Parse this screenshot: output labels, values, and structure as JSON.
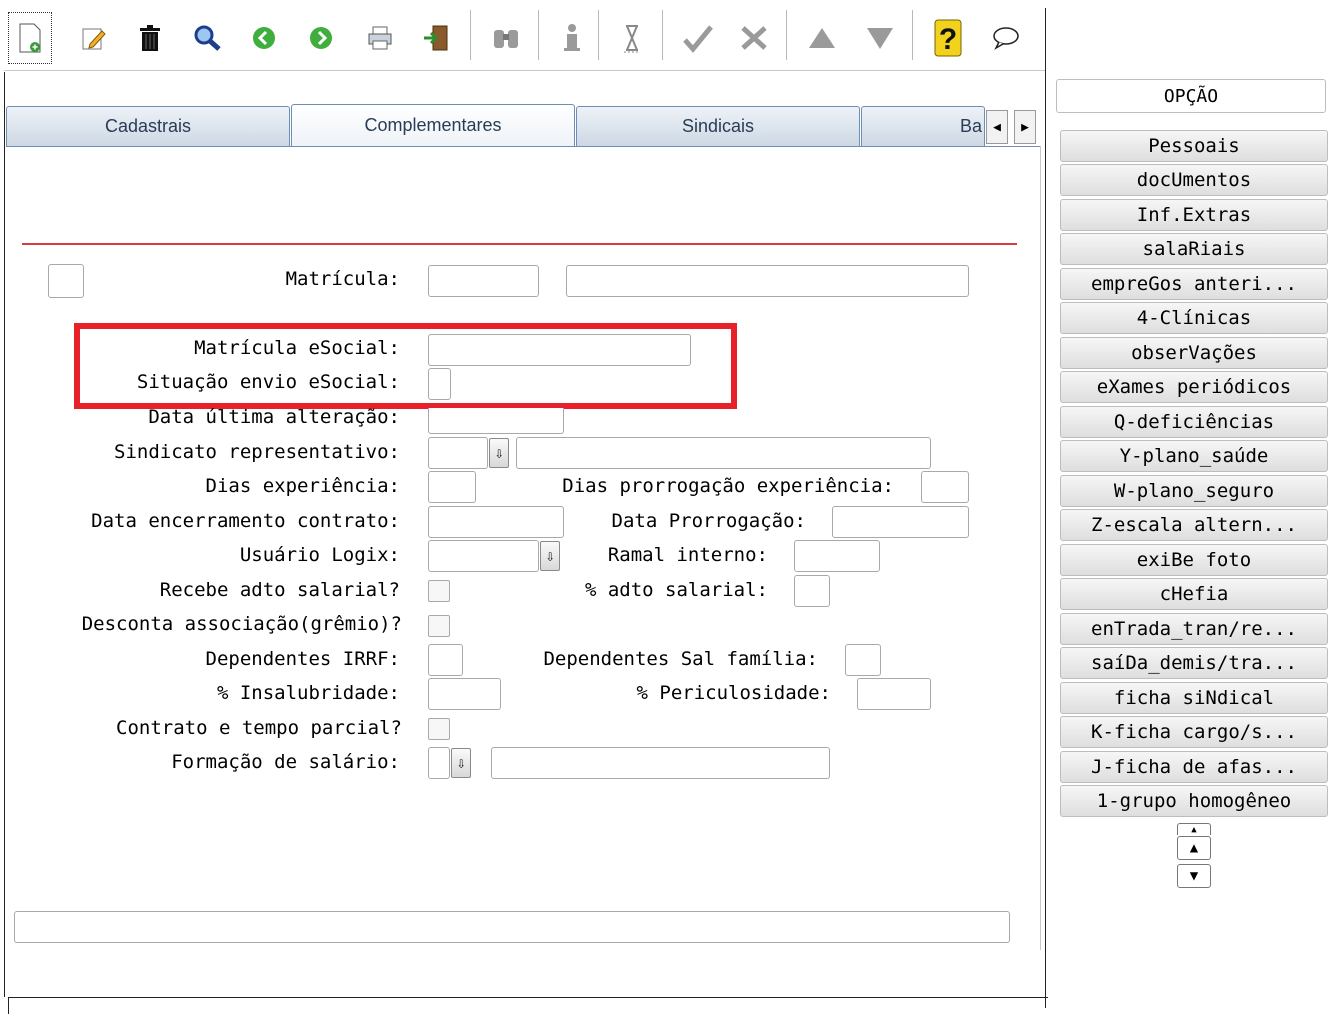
{
  "toolbar": {
    "icons": [
      {
        "name": "new-document-icon",
        "glyph": "🗋"
      },
      {
        "name": "edit-icon",
        "glyph": "✎"
      },
      {
        "name": "delete-icon",
        "glyph": "🗑"
      },
      {
        "name": "search-icon",
        "glyph": "🔍"
      },
      {
        "name": "previous-icon",
        "glyph": "◀"
      },
      {
        "name": "next-icon",
        "glyph": "▶"
      },
      {
        "name": "print-icon",
        "glyph": "⎙"
      },
      {
        "name": "exit-icon",
        "glyph": "⇥"
      },
      {
        "name": "binoculars-icon",
        "glyph": "⚲"
      },
      {
        "name": "info-icon",
        "glyph": "ℹ"
      },
      {
        "name": "hourglass-icon",
        "glyph": "⌛"
      },
      {
        "name": "confirm-icon",
        "glyph": "✔"
      },
      {
        "name": "cancel-icon",
        "glyph": "✖"
      },
      {
        "name": "up-icon",
        "glyph": "▲"
      },
      {
        "name": "down-icon",
        "glyph": "▼"
      },
      {
        "name": "help-icon",
        "glyph": "?"
      },
      {
        "name": "comment-icon",
        "glyph": "💬"
      }
    ]
  },
  "tabs": [
    "Cadastrais",
    "Complementares",
    "Sindicais",
    "Ba"
  ],
  "form": {
    "matricula": "Matrícula:",
    "matricula_esocial": "Matrícula eSocial:",
    "situacao_esocial": "Situação envio eSocial:",
    "data_ultima_alteracao": "Data última alteração:",
    "sindicato_representativo": "Sindicato representativo:",
    "dias_experiencia": "Dias experiência:",
    "dias_prorrogacao": "Dias prorrogação experiência:",
    "data_encerramento": "Data encerramento contrato:",
    "data_prorrogacao": "Data Prorrogação:",
    "usuario_logix": "Usuário Logix:",
    "ramal_interno": "Ramal interno:",
    "recebe_adto": "Recebe adto salarial?",
    "pct_adto": "% adto salarial:",
    "desconta_associacao": "Desconta associação(grêmio)?",
    "dependentes_irrf": "Dependentes IRRF:",
    "dependentes_sal_familia": "Dependentes Sal família:",
    "pct_insalubridade": "% Insalubridade:",
    "pct_periculosidade": "% Periculosidade:",
    "contrato_tempo_parcial": "Contrato e tempo parcial?",
    "formacao_salario": "Formação de salário:"
  },
  "highlight_color": "#e8202a",
  "options_panel": {
    "header": "OPÇÃO",
    "buttons": [
      "Pessoais",
      "docUmentos",
      "Inf.Extras",
      "salaRiais",
      "empreGos anteri...",
      "4-Clínicas",
      "obserVações",
      "eXames periódicos",
      "Q-deficiências",
      "Y-plano_saúde",
      "W-plano_seguro",
      "Z-escala altern...",
      "exiBe foto",
      "cHefia",
      "enTrada_tran/re...",
      "saíDa_demis/tra...",
      "ficha siNdical",
      "K-ficha cargo/s...",
      "J-ficha de afas...",
      "1-grupo homogêneo"
    ]
  }
}
